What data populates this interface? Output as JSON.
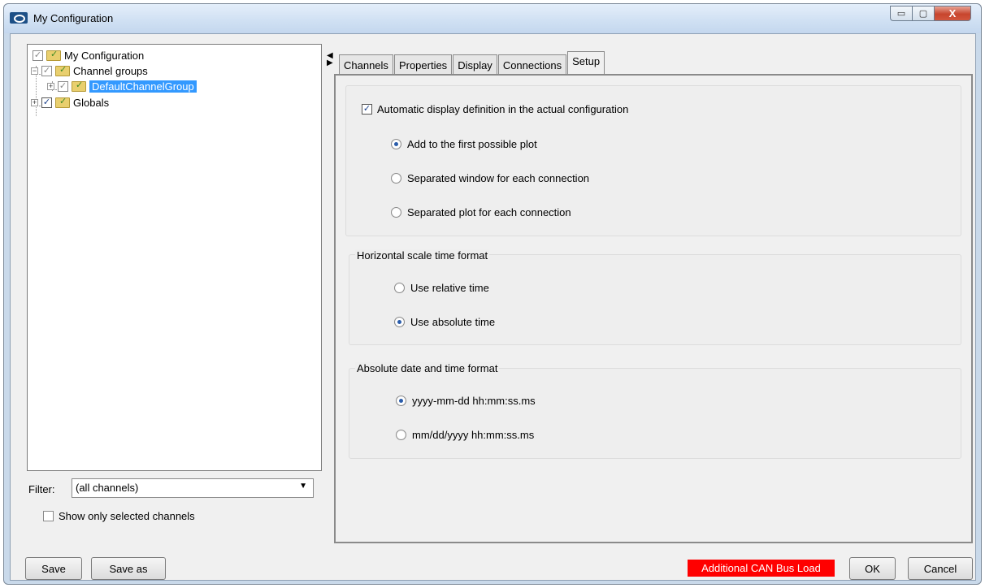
{
  "window": {
    "title": "My Configuration",
    "close_glyph": "X",
    "minimize_glyph": "▭",
    "maximize_glyph": "▢"
  },
  "tree": {
    "root": "My Configuration",
    "channel_groups": "Channel groups",
    "default_group": "DefaultChannelGroup",
    "globals": "Globals",
    "expand_glyph": "+",
    "collapse_glyph": "−",
    "check_glyph": "✓"
  },
  "filter": {
    "label": "Filter:",
    "value": "(all channels)",
    "arrow_glyph": "▼"
  },
  "show_only": {
    "label": "Show only selected channels",
    "checked": false
  },
  "splitter": {
    "glyph_top": "◀",
    "glyph_bottom": "▶"
  },
  "tabs": [
    "Channels",
    "Properties",
    "Display",
    "Connections",
    "Setup"
  ],
  "active_tab": "Setup",
  "setup": {
    "auto_display": {
      "label": "Automatic display definition in the actual configuration",
      "checked": true
    },
    "display_options": [
      {
        "label": "Add to the first possible plot",
        "selected": true
      },
      {
        "label": "Separated window for each connection",
        "selected": false
      },
      {
        "label": "Separated plot for each connection",
        "selected": false
      }
    ],
    "horizontal_scale": {
      "title": "Horizontal scale time format",
      "options": [
        {
          "label": "Use relative time",
          "selected": false
        },
        {
          "label": "Use absolute time",
          "selected": true
        }
      ]
    },
    "date_format": {
      "title": "Absolute date and time format",
      "options": [
        {
          "label": "yyyy-mm-dd hh:mm:ss.ms",
          "selected": true
        },
        {
          "label": "mm/dd/yyyy hh:mm:ss.ms",
          "selected": false
        }
      ]
    }
  },
  "footer": {
    "save": "Save",
    "save_as": "Save as",
    "can_load": "Additional CAN Bus Load",
    "ok": "OK",
    "cancel": "Cancel"
  },
  "colors": {
    "selection": "#3399ff",
    "can_load_bg": "#ff0000",
    "titlebar": "#cfe0f3"
  }
}
